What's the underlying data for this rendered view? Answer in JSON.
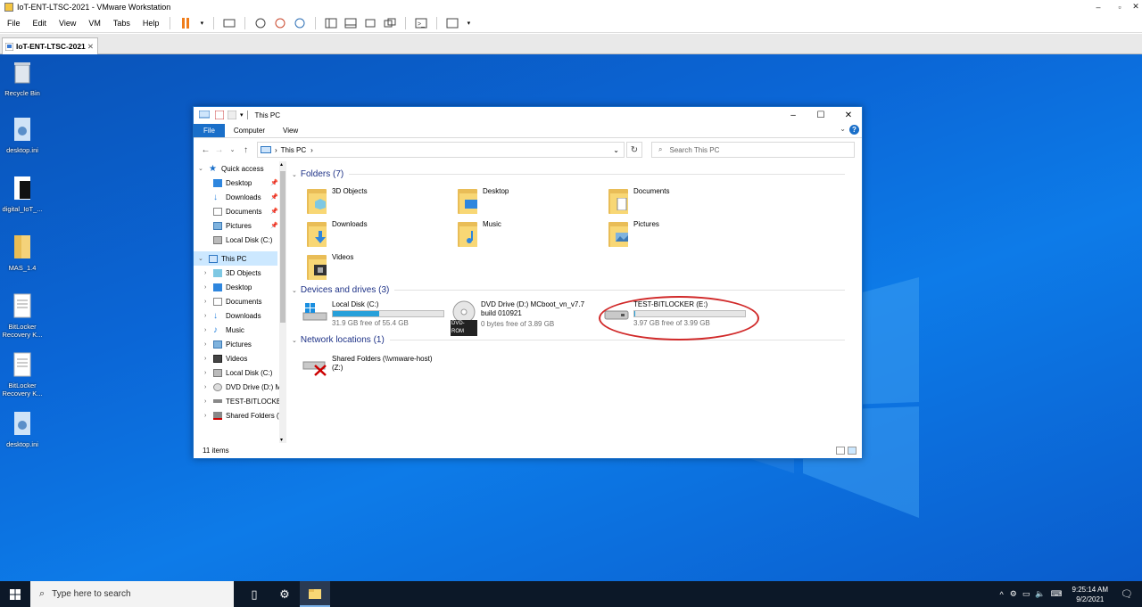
{
  "vmware": {
    "title": "IoT-ENT-LTSC-2021 - VMware Workstation",
    "menu": [
      "File",
      "Edit",
      "View",
      "VM",
      "Tabs",
      "Help"
    ],
    "tab_label": "IoT-ENT-LTSC-2021"
  },
  "desktop": {
    "icons": [
      {
        "label": "Recycle Bin",
        "icon": "recycle-bin-icon"
      },
      {
        "label": "desktop.ini",
        "icon": "settings-file-icon"
      },
      {
        "label": "digital_IoT_...",
        "icon": "script-file-icon"
      },
      {
        "label": "MAS_1.4",
        "icon": "folder-icon"
      },
      {
        "label": "BitLocker Recovery K...",
        "icon": "text-file-icon"
      },
      {
        "label": "BitLocker Recovery K...",
        "icon": "text-file-icon"
      },
      {
        "label": "desktop.ini",
        "icon": "settings-file-icon"
      }
    ]
  },
  "explorer": {
    "title": "This PC",
    "ribbon_tabs": [
      "File",
      "Computer",
      "View"
    ],
    "address": "This PC",
    "search_placeholder": "Search This PC",
    "tree": {
      "quick_access": "Quick access",
      "quick_items": [
        "Desktop",
        "Downloads",
        "Documents",
        "Pictures",
        "Local Disk (C:)"
      ],
      "this_pc": "This PC",
      "pc_items": [
        "3D Objects",
        "Desktop",
        "Documents",
        "Downloads",
        "Music",
        "Pictures",
        "Videos",
        "Local Disk (C:)",
        "DVD Drive (D:) M",
        "TEST-BITLOCKER",
        "Shared Folders (\\"
      ]
    },
    "groups": {
      "folders": "Folders (7)",
      "devices": "Devices and drives (3)",
      "network": "Network locations (1)"
    },
    "folders": [
      "3D Objects",
      "Desktop",
      "Documents",
      "Downloads",
      "Music",
      "Pictures",
      "Videos"
    ],
    "drives": [
      {
        "name": "Local Disk (C:)",
        "free": "31.9 GB free of 55.4 GB",
        "used_fraction": 0.42
      },
      {
        "name": "DVD Drive (D:) MCboot_vn_v7.7 build 010921",
        "free": "0 bytes free of 3.89 GB",
        "badge": "DVD-ROM"
      },
      {
        "name": "TEST-BITLOCKER (E:)",
        "free": "3.97 GB free of 3.99 GB",
        "used_fraction": 0.005
      }
    ],
    "network": {
      "name": "Shared Folders (\\\\vmware-host) (Z:)"
    },
    "status": "11 items"
  },
  "taskbar": {
    "search_placeholder": "Type here to search",
    "time": "9:25:14 AM",
    "date": "9/2/2021"
  }
}
